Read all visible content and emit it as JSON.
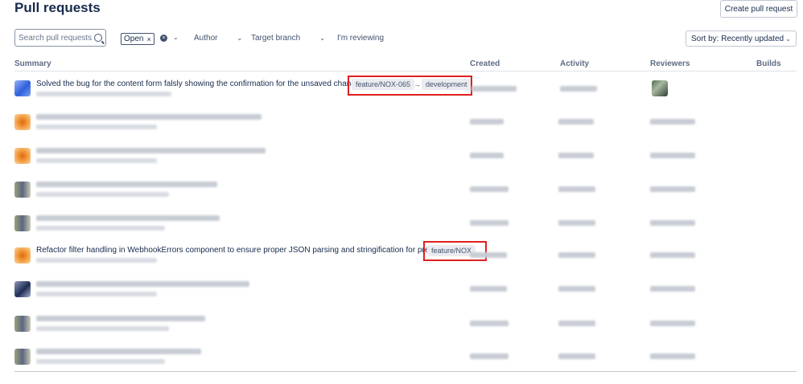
{
  "page": {
    "title": "Pull requests",
    "create_button": "Create pull request"
  },
  "filters": {
    "search_placeholder": "Search pull requests",
    "state_chip": "Open",
    "author": "Author",
    "target_branch": "Target branch",
    "reviewing": "I'm reviewing",
    "sort": "Sort by: Recently updated"
  },
  "columns": {
    "summary": "Summary",
    "created": "Created",
    "activity": "Activity",
    "reviewers": "Reviewers",
    "builds": "Builds"
  },
  "rows": [
    {
      "title": "Solved the bug for the content form falsly showing the confirmation for the unsaved changes",
      "source_branch": "feature/NOX-065",
      "arrow": "→",
      "target_branch": "development"
    },
    {
      "title": "Refactor filter handling in WebhookErrors component to ensure proper JSON parsing and stringification for presets.",
      "source_branch": "feature/NOX"
    }
  ],
  "icons": {
    "search": "search-icon",
    "clear": "clear-icon",
    "chevron": "chevron-down-icon"
  },
  "colors": {
    "highlight": "#e02020",
    "branch_bg": "#ebecf0"
  }
}
